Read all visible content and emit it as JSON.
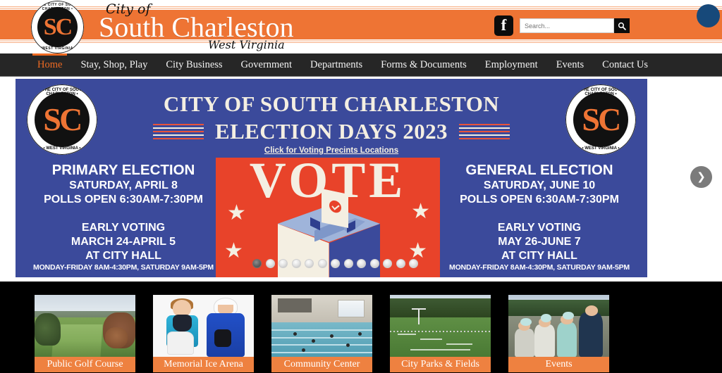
{
  "site": {
    "logo_alt": "The City of South Charleston West Virginia Seal",
    "seal_mono": "SC",
    "seal_arc_top": "• THE CITY OF SOUTH CHARLESTON •",
    "seal_arc_bottom": "• WEST VIRGINIA •",
    "wordmark_pre": "City of",
    "wordmark_main": "South Charleston",
    "wordmark_state": "West Virginia"
  },
  "header": {
    "facebook_label": "f",
    "search": {
      "placeholder": "Search...",
      "value": "",
      "button_icon": "search-icon"
    },
    "chat_widget_label": ""
  },
  "nav": {
    "items": [
      {
        "label": "Home",
        "active": true
      },
      {
        "label": "Stay, Shop, Play",
        "active": false
      },
      {
        "label": "City Business",
        "active": false
      },
      {
        "label": "Government",
        "active": false
      },
      {
        "label": "Departments",
        "active": false
      },
      {
        "label": "Forms & Documents",
        "active": false
      },
      {
        "label": "Employment",
        "active": false
      },
      {
        "label": "Events",
        "active": false
      },
      {
        "label": "Contact Us",
        "active": false
      }
    ]
  },
  "banner": {
    "title": "CITY OF SOUTH CHARLESTON",
    "subtitle": "ELECTION DAYS 2023",
    "link_text": "Click for Voting Precints Locations",
    "vote_word": "VOTE",
    "left": {
      "heading": "PRIMARY ELECTION",
      "date": "SATURDAY, APRIL 8",
      "polls": "POLLS OPEN 6:30AM-7:30PM",
      "early_heading": "EARLY VOTING",
      "early_dates": "MARCH 24-APRIL 5",
      "early_place": "AT CITY HALL",
      "early_hours": "MONDAY-FRIDAY 8AM-4:30PM,  SATURDAY 9AM-5PM"
    },
    "right": {
      "heading": "GENERAL ELECTION",
      "date": "SATURDAY, JUNE 10",
      "polls": "POLLS OPEN 6:30AM-7:30PM",
      "early_heading": "EARLY VOTING",
      "early_dates": "MAY 26-JUNE 7",
      "early_place": "AT CITY HALL",
      "early_hours": "MONDAY-FRIDAY 8AM-4:30PM,  SATURDAY 9AM-5PM"
    },
    "next_arrow_icon": "chevron-right-icon",
    "dots_total": 13,
    "dots_active_index": 0
  },
  "tiles": [
    {
      "caption": "Public Golf Course",
      "scene": "golf"
    },
    {
      "caption": "Memorial Ice Arena",
      "scene": "ice"
    },
    {
      "caption": "Community Center",
      "scene": "pool"
    },
    {
      "caption": "City Parks & Fields",
      "scene": "field"
    },
    {
      "caption": "Events",
      "scene": "events"
    }
  ],
  "colors": {
    "brand_orange": "#ee7434",
    "nav_dark": "#262626",
    "banner_blue": "#3b4a9b",
    "vote_red": "#e8432a",
    "cream": "#f4efe2",
    "tile_strip": "#000000",
    "chat_navy": "#17497a"
  }
}
